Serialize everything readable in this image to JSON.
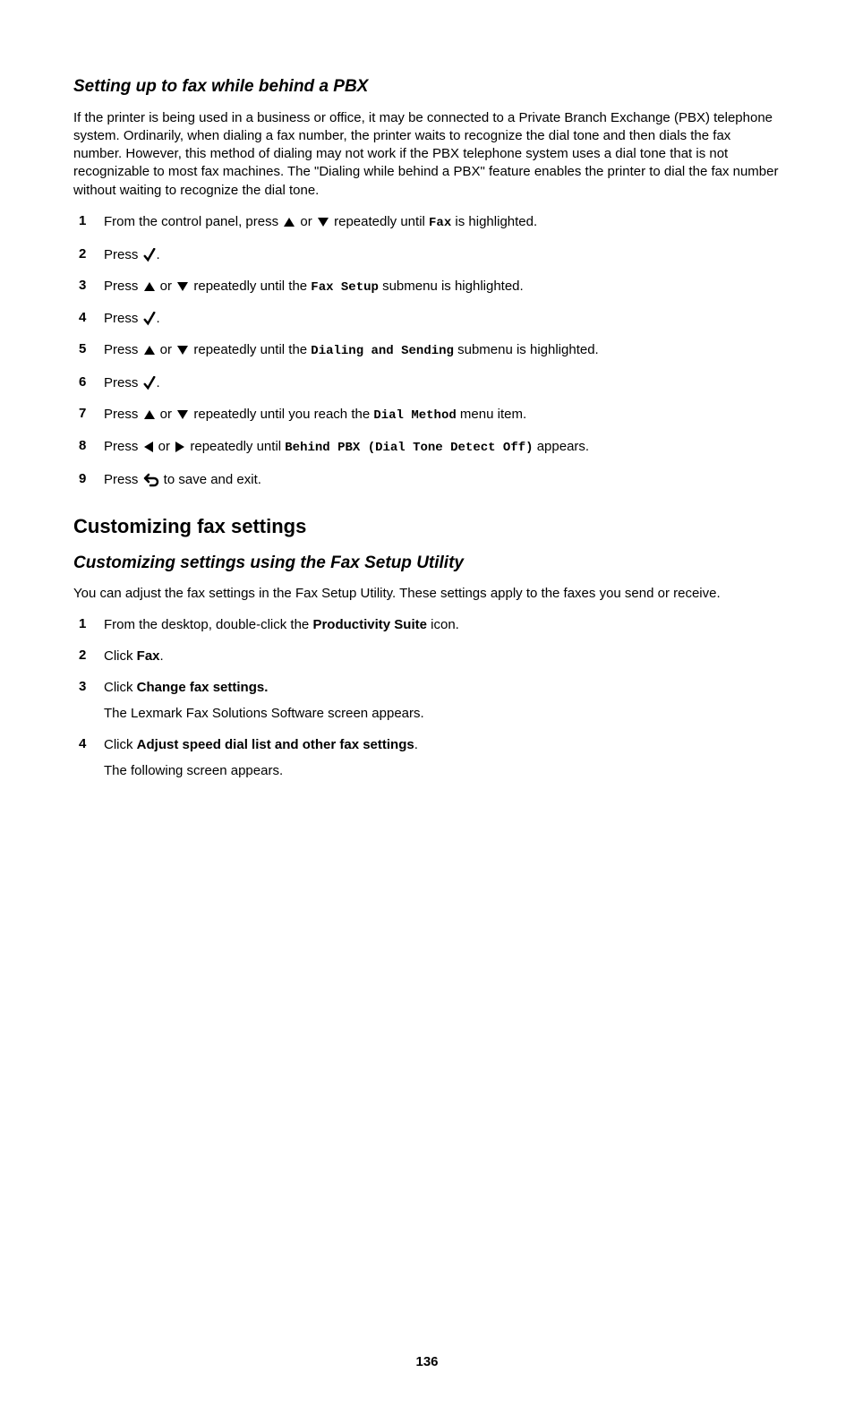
{
  "section1": {
    "heading": "Setting up to fax while behind a PBX",
    "intro": "If the printer is being used in a business or office, it may be connected to a Private Branch Exchange (PBX) telephone system. Ordinarily, when dialing a fax number, the printer waits to recognize the dial tone and then dials the fax number. However, this method of dialing may not work if the PBX telephone system uses a dial tone that is not recognizable to most fax machines. The \"Dialing while behind a PBX\" feature enables the printer to dial the fax number without waiting to recognize the dial tone.",
    "steps": {
      "n1": "1",
      "s1a": "From the control panel, press ",
      "s1b": " or ",
      "s1c": " repeatedly until ",
      "s1d": "Fax",
      "s1e": " is highlighted.",
      "n2": "2",
      "s2a": "Press ",
      "s2b": ".",
      "n3": "3",
      "s3a": "Press ",
      "s3b": " or ",
      "s3c": " repeatedly until the ",
      "s3d": "Fax Setup",
      "s3e": " submenu is highlighted.",
      "n4": "4",
      "s4a": "Press ",
      "s4b": ".",
      "n5": "5",
      "s5a": "Press ",
      "s5b": " or ",
      "s5c": " repeatedly until the ",
      "s5d": "Dialing and Sending",
      "s5e": " submenu is highlighted.",
      "n6": "6",
      "s6a": "Press ",
      "s6b": ".",
      "n7": "7",
      "s7a": "Press ",
      "s7b": " or ",
      "s7c": " repeatedly until you reach the ",
      "s7d": "Dial Method",
      "s7e": " menu item.",
      "n8": "8",
      "s8a": "Press ",
      "s8b": " or ",
      "s8c": " repeatedly until ",
      "s8d": "Behind PBX (Dial Tone Detect Off)",
      "s8e": " appears.",
      "n9": "9",
      "s9a": "Press ",
      "s9b": " to save and exit."
    }
  },
  "section2": {
    "main_heading": "Customizing fax settings",
    "sub_heading": "Customizing settings using the Fax Setup Utility",
    "intro": "You can adjust the fax settings in the Fax Setup Utility. These settings apply to the faxes you send or receive.",
    "steps": {
      "n1": "1",
      "s1a": "From the desktop, double-click the ",
      "s1b": "Productivity Suite",
      "s1c": " icon.",
      "n2": "2",
      "s2a": "Click ",
      "s2b": "Fax",
      "s2c": ".",
      "n3": "3",
      "s3a": "Click ",
      "s3b": "Change fax settings.",
      "s3sub": "The Lexmark Fax Solutions Software screen appears.",
      "n4": "4",
      "s4a": "Click ",
      "s4b": "Adjust speed dial list and other fax settings",
      "s4c": ".",
      "s4sub": "The following screen appears."
    }
  },
  "page_number": "136"
}
